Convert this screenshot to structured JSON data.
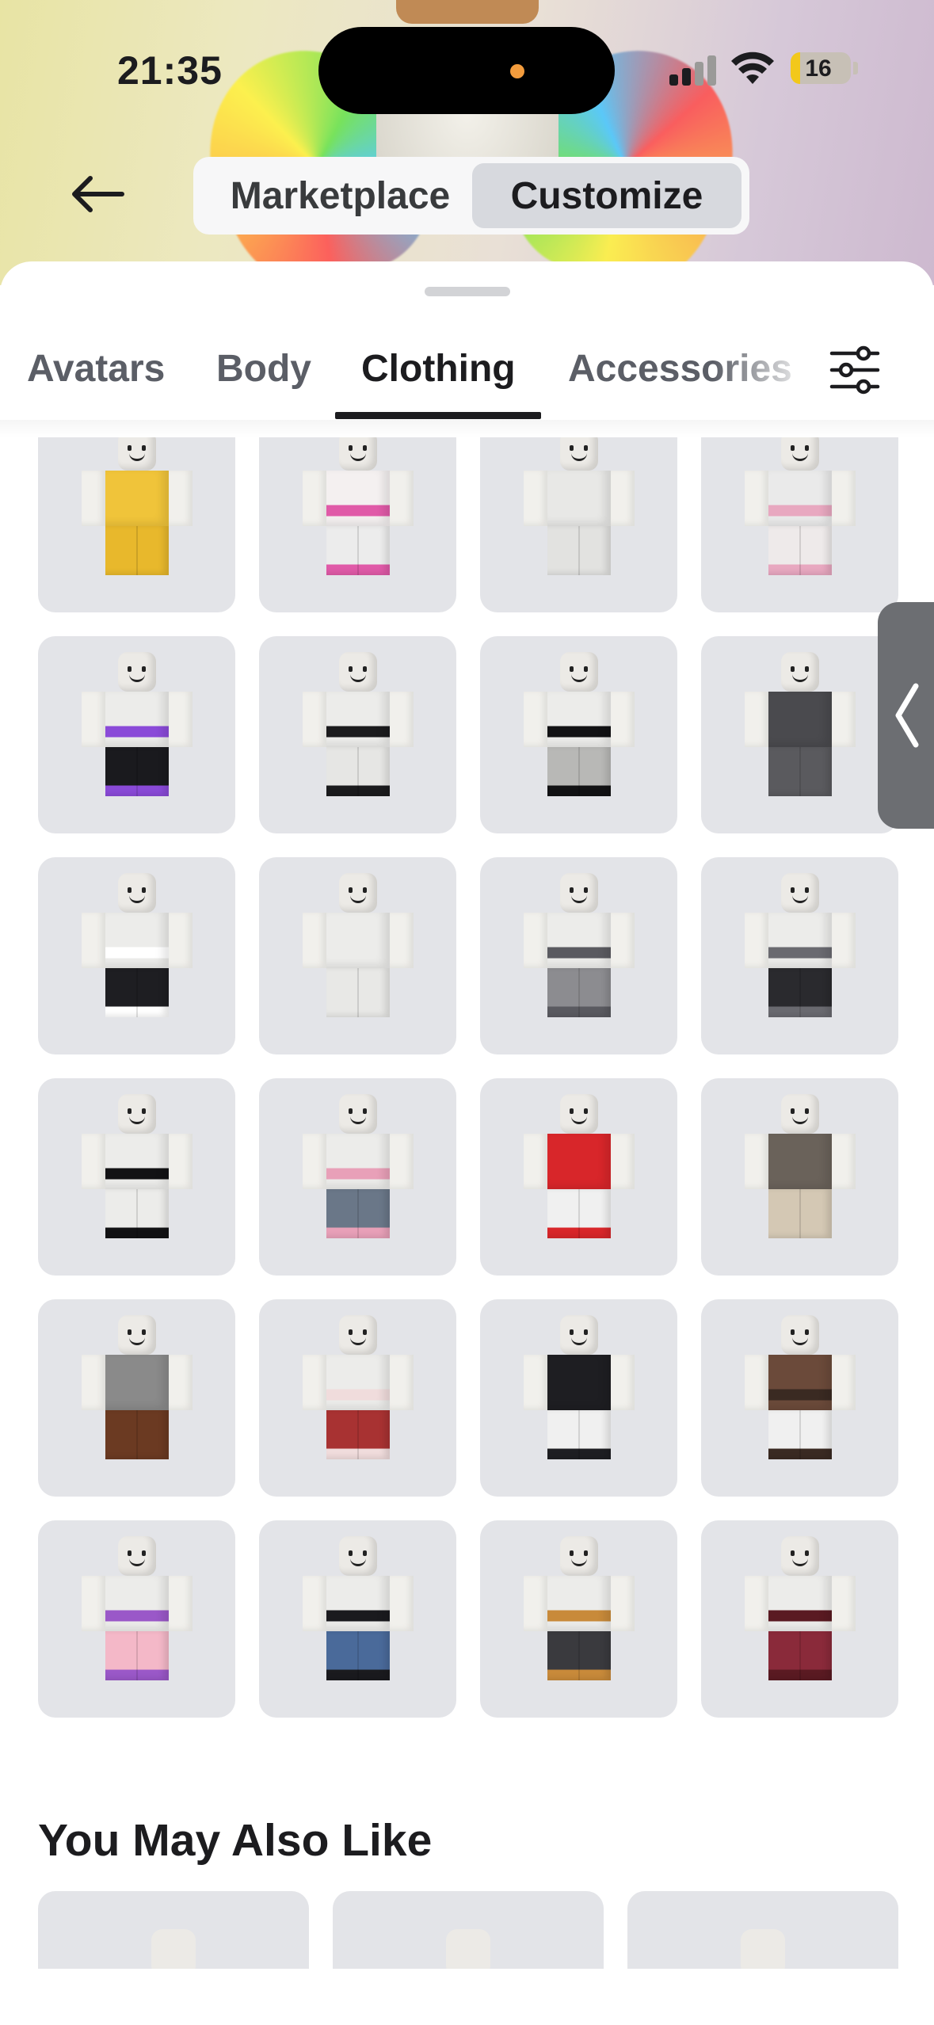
{
  "status_bar": {
    "time": "21:35",
    "battery_level": "16",
    "icons": [
      "signal-icon",
      "wifi-icon",
      "battery-icon"
    ]
  },
  "header": {
    "back_icon": "arrow-left-icon",
    "segments": [
      {
        "label": "Marketplace",
        "selected": false
      },
      {
        "label": "Customize",
        "selected": true
      }
    ]
  },
  "tabs": {
    "items": [
      {
        "label": "Avatars",
        "active": false
      },
      {
        "label": "Body",
        "active": false
      },
      {
        "label": "Clothing",
        "active": true
      },
      {
        "label": "Accessories",
        "active": false
      }
    ],
    "filter_icon": "sliders-icon"
  },
  "grid": {
    "items": [
      {
        "top": "#f0c43a",
        "bottom": "#e8b82c",
        "note": "yellow"
      },
      {
        "top": "#f4f0f0",
        "bottom": "#ececec",
        "accent": "#e05aa8"
      },
      {
        "top": "#e8e8e6",
        "bottom": "#e2e2e0"
      },
      {
        "top": "#eaeaea",
        "bottom": "#eeeaea",
        "accent": "#e8a8c0"
      },
      {
        "top": "#ececea",
        "bottom": "#1a1a1e",
        "accent": "#8a4ad8"
      },
      {
        "top": "#ececea",
        "bottom": "#e6e6e4",
        "accent": "#1b1b1d"
      },
      {
        "top": "#ececea",
        "bottom": "#b8b8b6",
        "accent": "#121214"
      },
      {
        "top": "#4a4a4e",
        "bottom": "#5a5a5e"
      },
      {
        "top": "#ececea",
        "bottom": "#1e1e22",
        "accent": "#ffffff"
      },
      {
        "top": "#ececea",
        "bottom": "#e8e8e6"
      },
      {
        "top": "#ececea",
        "bottom": "#8c8c90",
        "accent": "#5a5a60"
      },
      {
        "top": "#ececea",
        "bottom": "#2a2a2e",
        "accent": "#6a6a70"
      },
      {
        "top": "#ececea",
        "bottom": "#ececea",
        "accent": "#121214"
      },
      {
        "top": "#ececea",
        "bottom": "#6a7788",
        "accent": "#e8a0b8"
      },
      {
        "top": "#d8262a",
        "bottom": "#f0f0f0",
        "accent": "#d8262a"
      },
      {
        "top": "#6a625a",
        "bottom": "#d4c8b4"
      },
      {
        "top": "#8a8a8a",
        "bottom": "#6b3a22"
      },
      {
        "top": "#ececea",
        "bottom": "#a83232",
        "accent": "#f0dcdc"
      },
      {
        "top": "#1e1e22",
        "bottom": "#f0f0f0",
        "accent": "#1e1e22"
      },
      {
        "top": "#6b4a3a",
        "bottom": "#f0f0f0",
        "accent": "#3a2a22"
      },
      {
        "top": "#ececea",
        "bottom": "#f4b8c8",
        "accent": "#9a58c8"
      },
      {
        "top": "#ececea",
        "bottom": "#4a6a9a",
        "accent": "#1a1a1e"
      },
      {
        "top": "#ececea",
        "bottom": "#3a3a3e",
        "accent": "#c88a3a"
      },
      {
        "top": "#ececea",
        "bottom": "#8a2a3a",
        "accent": "#5a1a22"
      }
    ]
  },
  "you_may_also_like": {
    "title": "You May Also Like",
    "cards": 3
  },
  "side_tab": {
    "icon": "chevron-left-icon"
  },
  "colors": {
    "tile_bg": "#e3e4e8",
    "active_text": "#1c1c1f",
    "inactive_text": "#5b5e66",
    "segment_selected": "#d7d9de"
  }
}
